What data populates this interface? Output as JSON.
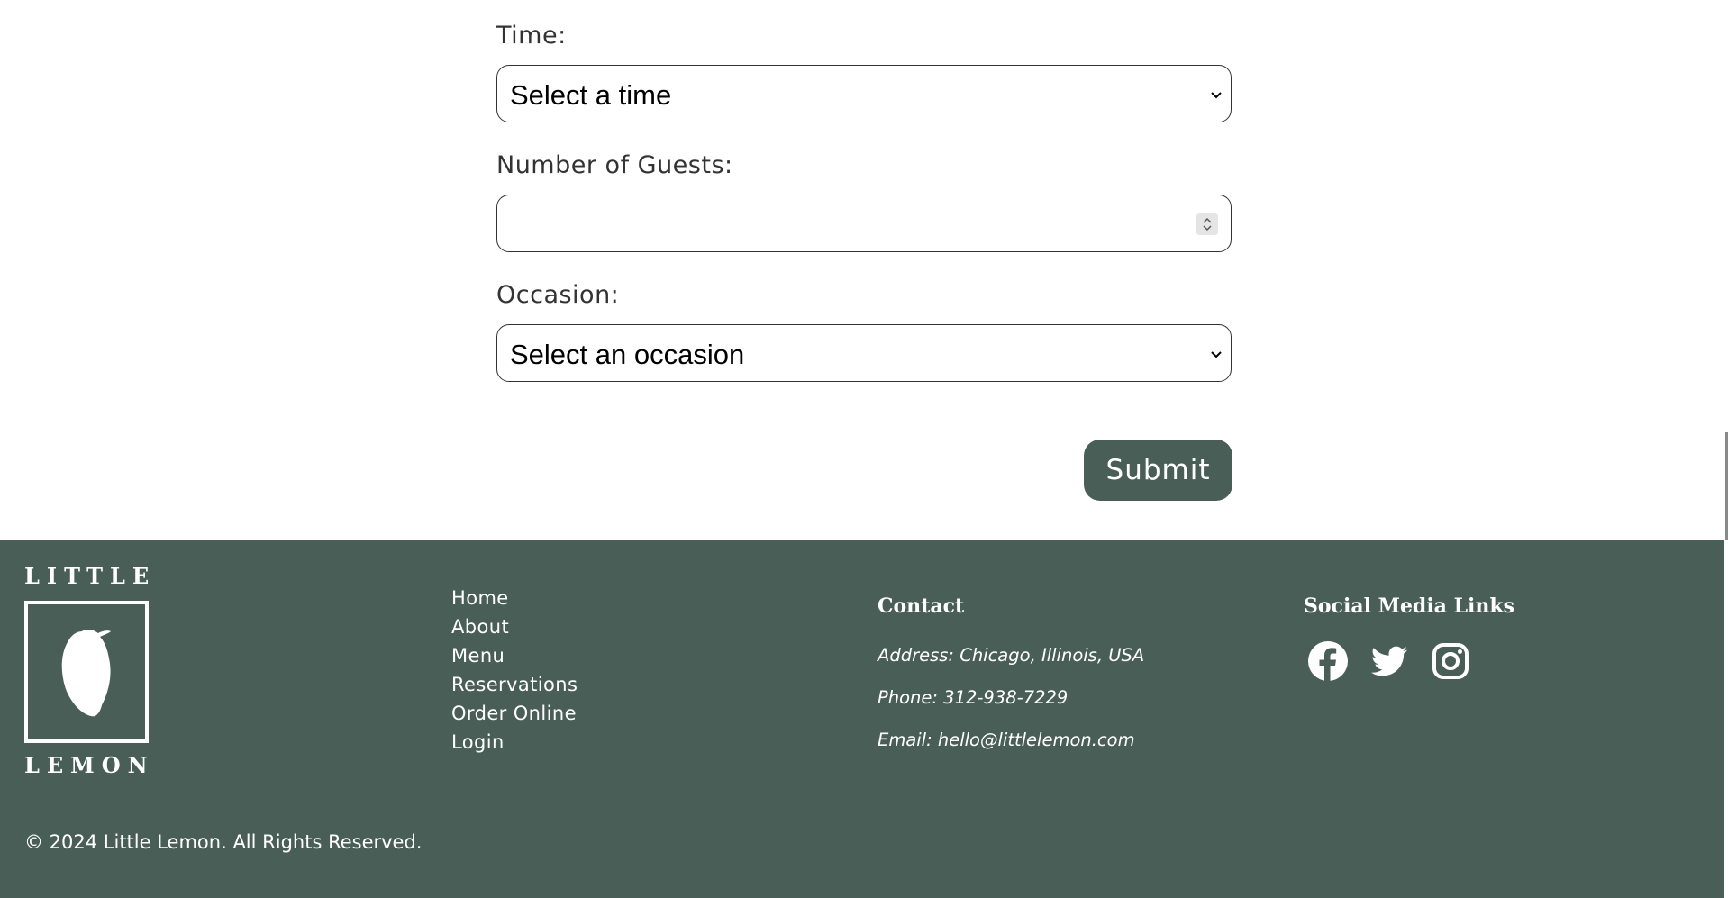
{
  "form": {
    "time_label": "Time:",
    "time_value": "Select a time",
    "guests_label": "Number of Guests:",
    "guests_value": "",
    "occasion_label": "Occasion:",
    "occasion_value": "Select an occasion",
    "submit_label": "Submit"
  },
  "footer": {
    "logo": {
      "top_word": "LITTLE",
      "bottom_word": "LEMON"
    },
    "nav": [
      {
        "label": "Home"
      },
      {
        "label": "About"
      },
      {
        "label": "Menu"
      },
      {
        "label": "Reservations"
      },
      {
        "label": "Order Online"
      },
      {
        "label": "Login"
      }
    ],
    "contact": {
      "heading": "Contact",
      "address": "Address: Chicago, Illinois, USA",
      "phone": "Phone: 312-938-7229",
      "email": "Email: hello@littlelemon.com"
    },
    "social": {
      "heading": "Social Media Links",
      "icons": [
        "facebook-icon",
        "twitter-icon",
        "instagram-icon"
      ]
    },
    "copyright": "© 2024 Little Lemon. All Rights Reserved."
  },
  "colors": {
    "brand_green": "#495e57",
    "text_dark": "#333333",
    "white": "#ffffff"
  }
}
